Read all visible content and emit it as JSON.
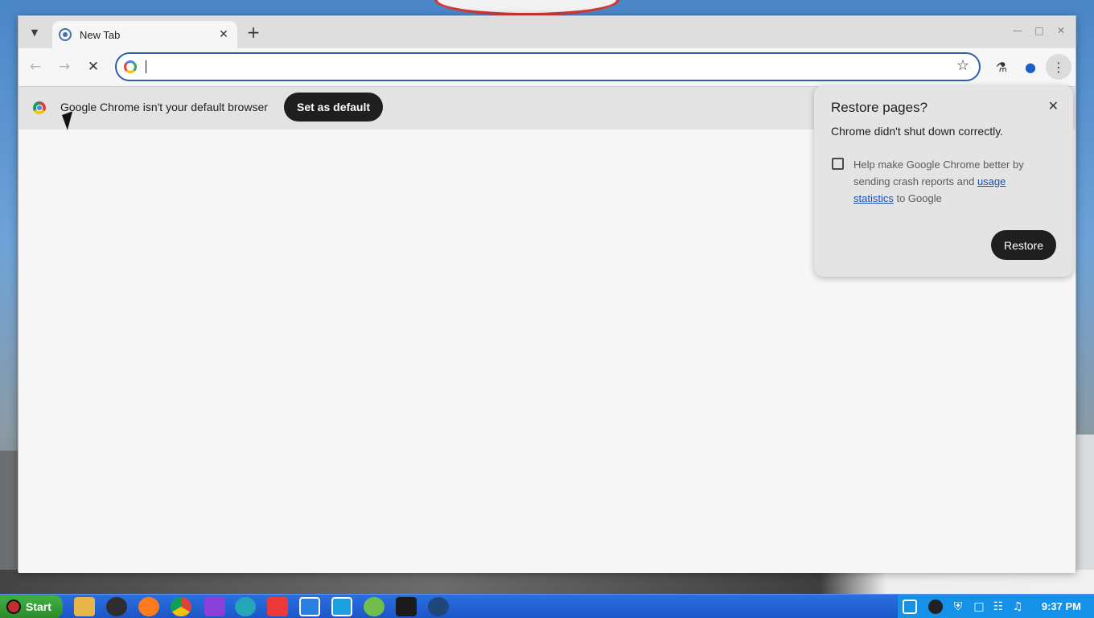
{
  "browser": {
    "tab": {
      "title": "New Tab"
    },
    "omnibox": {
      "value": "",
      "placeholder": ""
    }
  },
  "infobar": {
    "message": "Google Chrome isn't your default browser",
    "button_label": "Set as default"
  },
  "restore_popup": {
    "title": "Restore pages?",
    "body": "Chrome didn't shut down correctly.",
    "help_prefix": "Help make Google Chrome better by sending crash reports and ",
    "help_link": "usage statistics",
    "help_suffix": " to Google",
    "button_label": "Restore"
  },
  "taskbar": {
    "start_label": "Start",
    "clock": "9:37 PM",
    "apps": [
      "files",
      "obs-studio",
      "firefox",
      "chrome",
      "brave",
      "edge-dev",
      "vivaldi",
      "fastcopy",
      "system-monitor",
      "calculator",
      "terminal",
      "steam"
    ],
    "colors": {
      "bar": "#1c56c8",
      "tray": "#1591e8",
      "start": "#2b8c2b"
    }
  }
}
